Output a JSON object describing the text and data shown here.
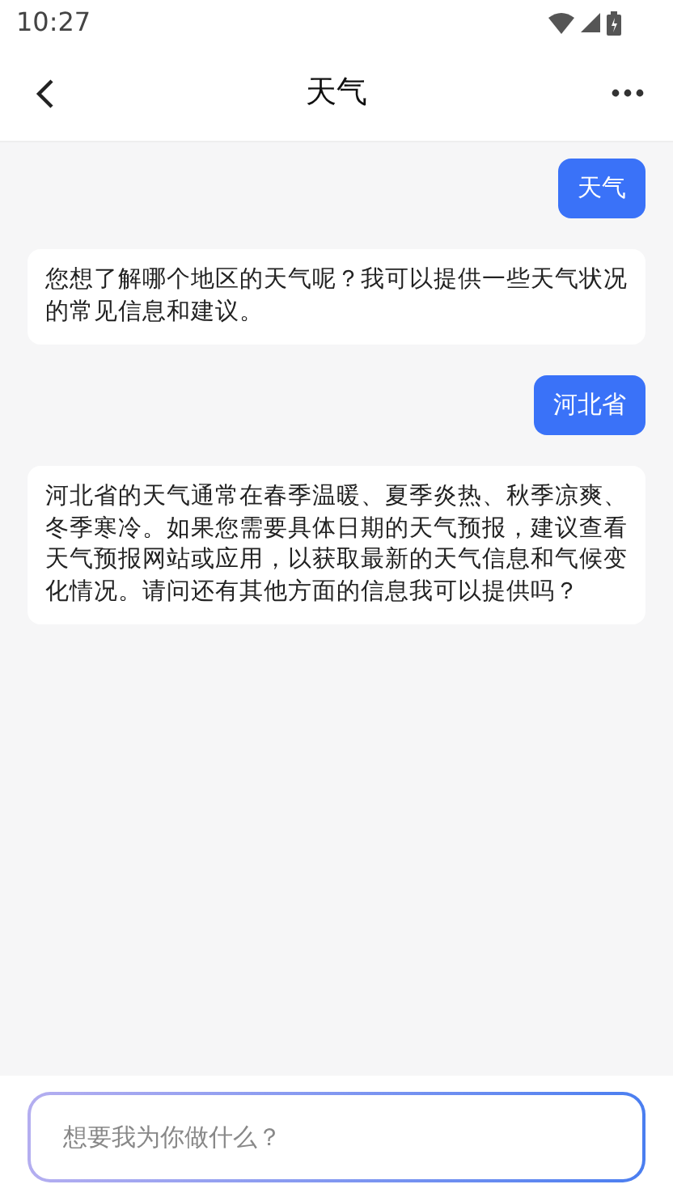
{
  "status_bar": {
    "time": "10:27"
  },
  "header": {
    "title": "天气"
  },
  "messages": [
    {
      "kind": "user",
      "text": "天气"
    },
    {
      "kind": "bot",
      "text": "您想了解哪个地区的天气呢？我可以提供一些天气状况的常见信息和建议。"
    },
    {
      "kind": "user",
      "text": "河北省"
    },
    {
      "kind": "bot",
      "text": "河北省的天气通常在春季温暖、夏季炎热、秋季凉爽、冬季寒冷。如果您需要具体日期的天气预报，建议查看天气预报网站或应用，以获取最新的天气信息和气候变化情况。请问还有其他方面的信息我可以提供吗？"
    }
  ],
  "composer": {
    "placeholder": "想要我为你做什么？"
  }
}
